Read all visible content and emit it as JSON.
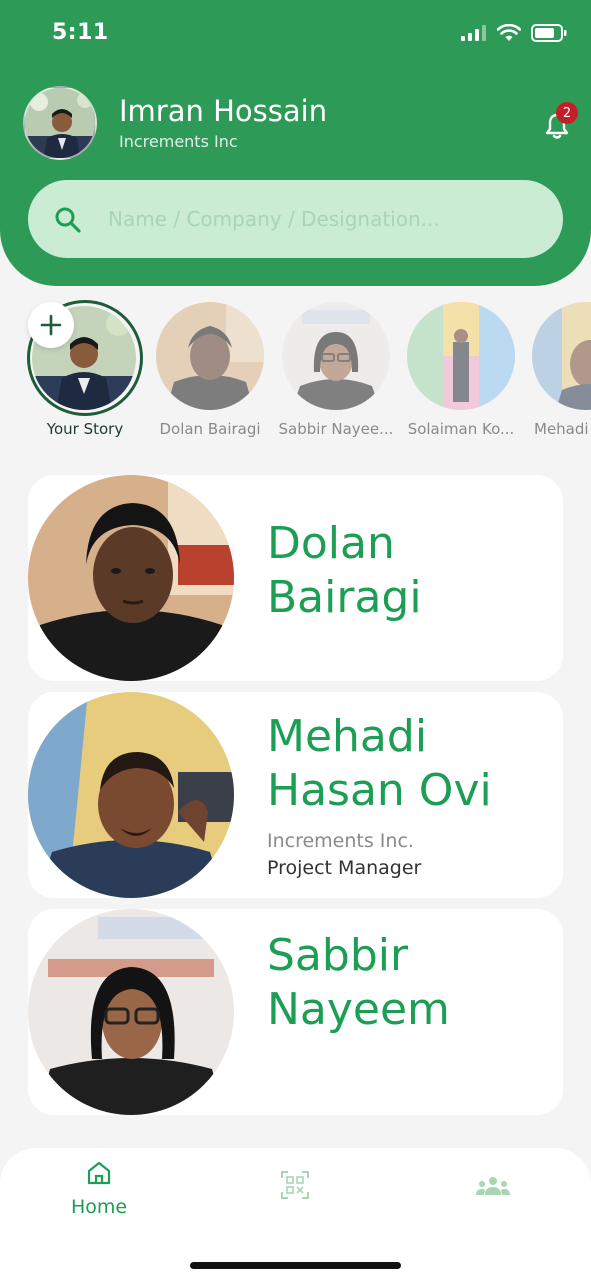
{
  "status_bar": {
    "time": "5:11"
  },
  "profile": {
    "name": "Imran Hossain",
    "company": "Increments Inc"
  },
  "notifications": {
    "count": "2"
  },
  "search": {
    "placeholder": "Name / Company / Designation..."
  },
  "stories": [
    {
      "label": "Your Story"
    },
    {
      "label": "Dolan Bairagi"
    },
    {
      "label": "Sabbir Nayee..."
    },
    {
      "label": "Solaiman Ko..."
    },
    {
      "label": "Mehadi"
    }
  ],
  "contacts": [
    {
      "name": "Dolan Bairagi",
      "company": "",
      "role": ""
    },
    {
      "name": "Mehadi Hasan Ovi",
      "company": "Increments Inc.",
      "role": "Project Manager"
    },
    {
      "name": "Sabbir Nayeem",
      "company": "",
      "role": ""
    }
  ],
  "nav": {
    "home_label": "Home",
    "items": [
      {
        "icon": "home-icon",
        "label": "Home",
        "active": true
      },
      {
        "icon": "qr-scan-icon",
        "active": false
      },
      {
        "icon": "group-icon",
        "active": false
      }
    ]
  },
  "colors": {
    "primary": "#2e9a57",
    "accent_text": "#1d9e55",
    "badge": "#c41f28",
    "search_bg": "#c9ecd2"
  }
}
